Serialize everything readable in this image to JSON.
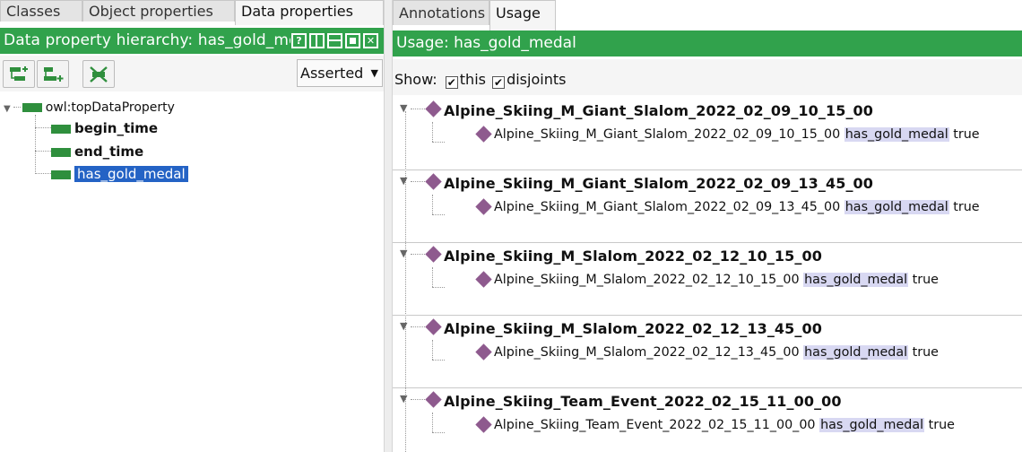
{
  "left": {
    "tabs": [
      "Classes",
      "Object properties",
      "Data properties"
    ],
    "header_title": "Data property hierarchy: has_gold_me",
    "asserted_label": "Asserted",
    "tree": {
      "root": "owl:topDataProperty",
      "children": [
        "begin_time",
        "end_time",
        "has_gold_medal"
      ],
      "selected": "has_gold_medal"
    }
  },
  "right": {
    "tabs": [
      "Annotations",
      "Usage"
    ],
    "header_title": "Usage: has_gold_medal",
    "show": {
      "label": "Show:",
      "this_label": "this",
      "disjoints_label": "disjoints"
    },
    "usages": [
      {
        "individual": "Alpine_Skiing_M_Giant_Slalom_2022_02_09_10_15_00",
        "subject": "Alpine_Skiing_M_Giant_Slalom_2022_02_09_10_15_00",
        "property": "has_gold_medal",
        "value": "true"
      },
      {
        "individual": "Alpine_Skiing_M_Giant_Slalom_2022_02_09_13_45_00",
        "subject": "Alpine_Skiing_M_Giant_Slalom_2022_02_09_13_45_00",
        "property": "has_gold_medal",
        "value": "true"
      },
      {
        "individual": "Alpine_Skiing_M_Slalom_2022_02_12_10_15_00",
        "subject": "Alpine_Skiing_M_Slalom_2022_02_12_10_15_00",
        "property": "has_gold_medal",
        "value": "true"
      },
      {
        "individual": "Alpine_Skiing_M_Slalom_2022_02_12_13_45_00",
        "subject": "Alpine_Skiing_M_Slalom_2022_02_12_13_45_00",
        "property": "has_gold_medal",
        "value": "true"
      },
      {
        "individual": "Alpine_Skiing_Team_Event_2022_02_15_11_00_00",
        "subject": "Alpine_Skiing_Team_Event_2022_02_15_11_00_00",
        "property": "has_gold_medal",
        "value": "true"
      }
    ]
  },
  "colors": {
    "header_green": "#31a24c",
    "property_green": "#2f8f3d",
    "individual_purple": "#8e5a8e",
    "selection_blue": "#2463c5",
    "highlight_lavender": "#d8d8f2"
  }
}
